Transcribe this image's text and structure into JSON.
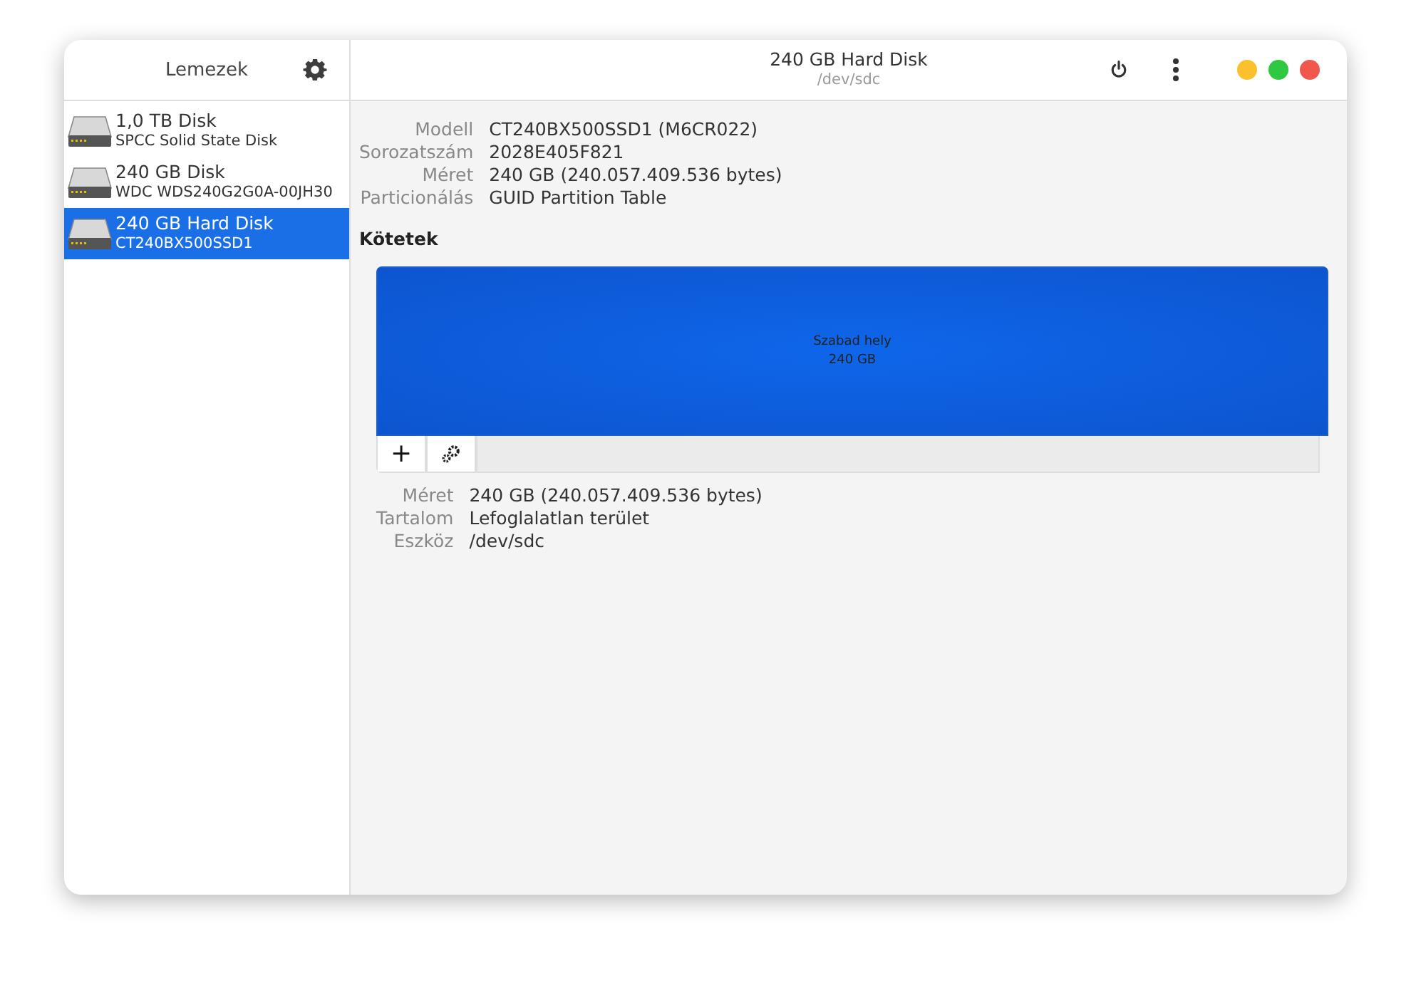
{
  "sidebar": {
    "title": "Lemezek",
    "items": [
      {
        "name": "1,0 TB Disk",
        "model": "SPCC Solid State Disk",
        "selected": false
      },
      {
        "name": "240 GB Disk",
        "model": "WDC WDS240G2G0A-00JH30",
        "selected": false
      },
      {
        "name": "240 GB Hard Disk",
        "model": "CT240BX500SSD1",
        "selected": true
      }
    ]
  },
  "header": {
    "title": "240 GB Hard Disk",
    "subtitle": "/dev/sdc"
  },
  "window_controls": [
    {
      "kind": "minimize",
      "color": "#fbc02d"
    },
    {
      "kind": "maximize",
      "color": "#2ec940"
    },
    {
      "kind": "close",
      "color": "#f0584d"
    }
  ],
  "disk_info": [
    {
      "label": "Modell",
      "value": "CT240BX500SSD1 (M6CR022)"
    },
    {
      "label": "Sorozatszám",
      "value": "2028E405F821"
    },
    {
      "label": "Méret",
      "value": "240 GB (240.057.409.536 bytes)"
    },
    {
      "label": "Particionálás",
      "value": "GUID Partition Table"
    }
  ],
  "volumes": {
    "title": "Kötetek",
    "segment": {
      "name": "Szabad hely",
      "size": "240 GB",
      "selected": true
    },
    "add_button": "+"
  },
  "volume_info": [
    {
      "label": "Méret",
      "value": "240 GB (240.057.409.536 bytes)"
    },
    {
      "label": "Tartalom",
      "value": "Lefoglalatlan terület"
    },
    {
      "label": "Eszköz",
      "value": "/dev/sdc"
    }
  ]
}
